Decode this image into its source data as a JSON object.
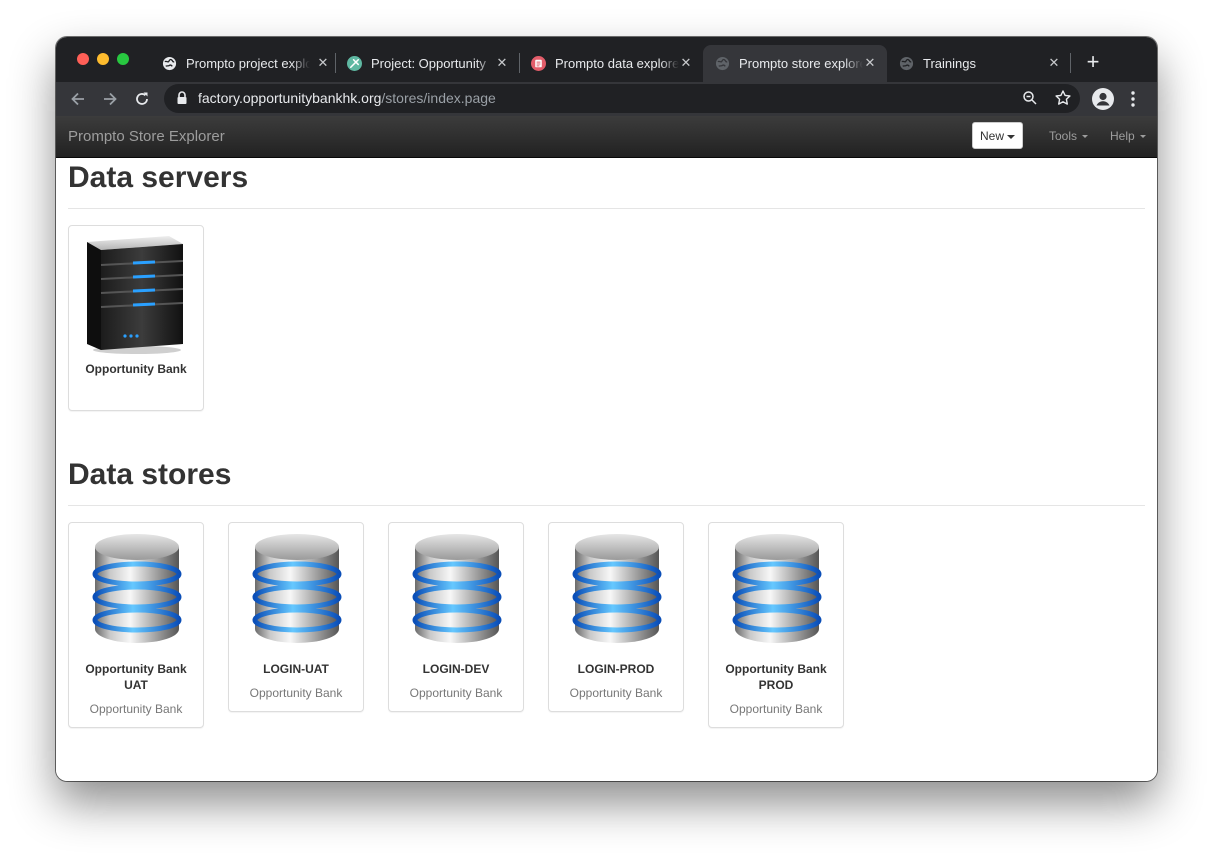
{
  "browser": {
    "tabs": [
      {
        "title": "Prompto project explorer",
        "active": false,
        "favicon": "globe-icon"
      },
      {
        "title": "Project: Opportunity",
        "active": false,
        "favicon": "tools-icon"
      },
      {
        "title": "Prompto data explorer",
        "active": false,
        "favicon": "data-icon"
      },
      {
        "title": "Prompto store explorer",
        "active": true,
        "favicon": "globe-icon"
      },
      {
        "title": "Trainings",
        "active": false,
        "favicon": "globe-icon"
      }
    ],
    "url_host": "factory.opportunitybankhk.org",
    "url_path": "/stores/index.page"
  },
  "app": {
    "brand": "Prompto Store Explorer",
    "new_label": "New",
    "tools_label": "Tools",
    "help_label": "Help"
  },
  "servers": {
    "title": "Data servers",
    "items": [
      {
        "name": "Opportunity Bank"
      }
    ]
  },
  "stores": {
    "title": "Data stores",
    "items": [
      {
        "name_line1": "Opportunity Bank",
        "name_line2": "UAT",
        "server": "Opportunity Bank"
      },
      {
        "name_line1": "LOGIN-UAT",
        "name_line2": "",
        "server": "Opportunity Bank"
      },
      {
        "name_line1": "LOGIN-DEV",
        "name_line2": "",
        "server": "Opportunity Bank"
      },
      {
        "name_line1": "LOGIN-PROD",
        "name_line2": "",
        "server": "Opportunity Bank"
      },
      {
        "name_line1": "Opportunity Bank",
        "name_line2": "PROD",
        "server": "Opportunity Bank"
      }
    ]
  },
  "colors": {
    "tabstrip": "#202124",
    "toolbar": "#35363a",
    "navbar": "#222222",
    "accent_blue": "#1e90ff"
  }
}
